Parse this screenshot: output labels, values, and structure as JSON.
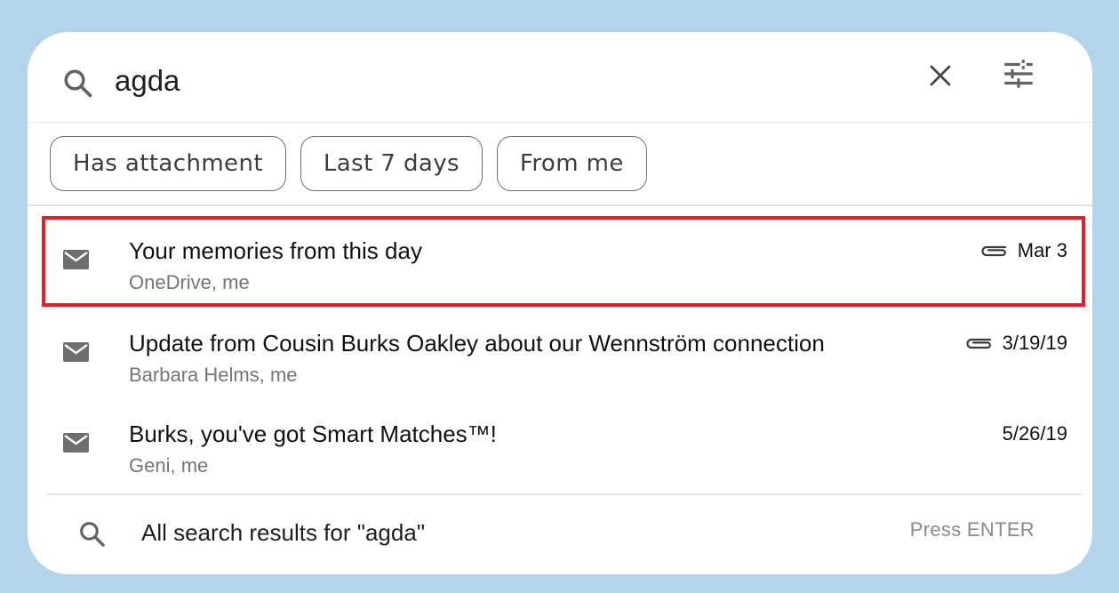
{
  "search": {
    "query": "agda",
    "clear_icon": "close-icon",
    "filters_icon": "tune-icon"
  },
  "chips": [
    {
      "label": "Has attachment"
    },
    {
      "label": "Last 7 days"
    },
    {
      "label": "From me"
    }
  ],
  "results": [
    {
      "subject": "Your memories from this day",
      "senders": "OneDrive, me",
      "date": "Mar 3",
      "has_attachment": true,
      "highlighted": true
    },
    {
      "subject": "Update from Cousin Burks Oakley about our Wennström connection",
      "senders": "Barbara Helms, me",
      "date": "3/19/19",
      "has_attachment": true,
      "highlighted": false
    },
    {
      "subject": "Burks, you've got Smart Matches™!",
      "senders": "Geni, me",
      "date": "5/26/19",
      "has_attachment": false,
      "highlighted": false
    }
  ],
  "all_results": {
    "label": "All search results for \"agda\"",
    "hint": "Press ENTER"
  },
  "colors": {
    "background": "#b4d4ec",
    "panel": "#ffffff",
    "highlight_border": "#e32028",
    "icon_gray": "#5f6368"
  }
}
